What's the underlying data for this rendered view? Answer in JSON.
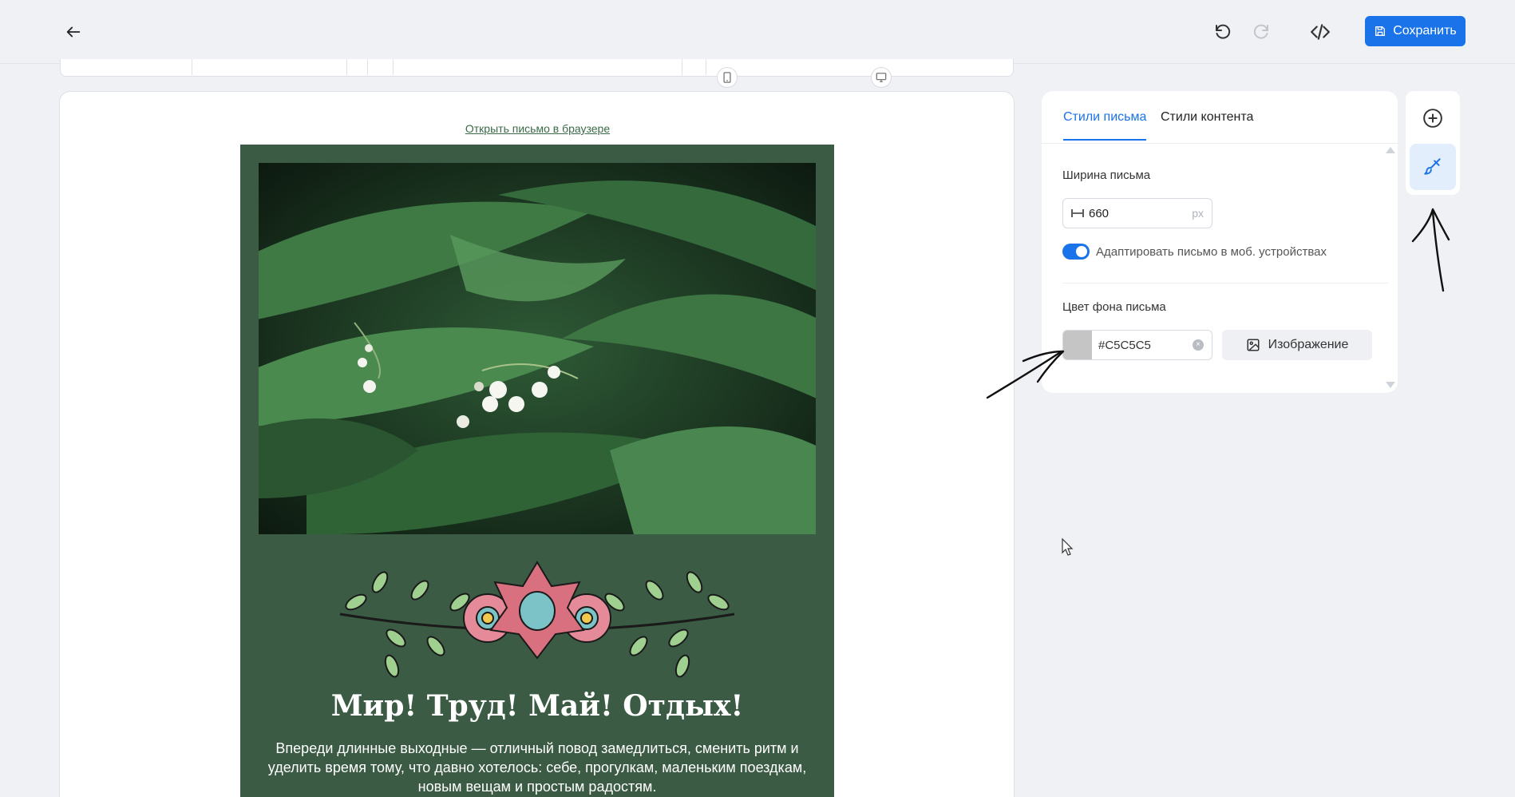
{
  "header": {
    "save_label": "Сохранить"
  },
  "email_preview": {
    "open_in_browser": "Открыть письмо в браузере",
    "headline": "Мир! Труд! Май! Отдых!",
    "body": "Впереди длинные выходные — отличный повод замедлиться, сменить ритм и уделить время тому, что давно хотелось: себе, прогулкам, маленьким поездкам, новым вещам и простым радостям."
  },
  "settings_panel": {
    "tabs": [
      {
        "label": "Стили письма",
        "active": true
      },
      {
        "label": "Стили контента",
        "active": false
      }
    ],
    "width_label": "Ширина письма",
    "width_value": "660",
    "width_unit": "px",
    "adaptive_label": "Адаптировать письмо в моб. устройствах",
    "adaptive_enabled": true,
    "bg_color_label": "Цвет фона письма",
    "bg_color_value": "#C5C5C5",
    "image_button_label": "Изображение"
  },
  "colors": {
    "accent": "#1a73e8",
    "email_bg": "#3b5b44",
    "swatch": "#c5c5c5"
  },
  "icons": [
    "arrow-left-icon",
    "undo-icon",
    "redo-icon",
    "code-icon",
    "save-icon",
    "mobile-icon",
    "desktop-icon",
    "width-icon",
    "clear-icon",
    "image-icon",
    "plus-circle-icon",
    "brush-icon"
  ]
}
